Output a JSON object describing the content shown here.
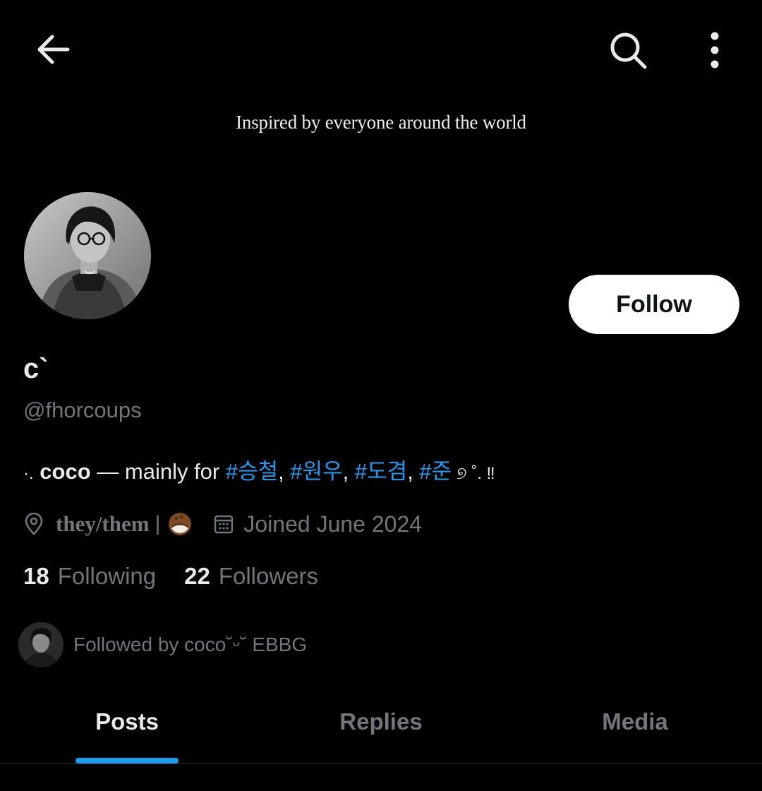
{
  "topbar": {
    "back_icon": "arrow-left-icon",
    "search_icon": "search-icon",
    "more_icon": "more-vertical-icon"
  },
  "banner": {
    "text": "Inspired by everyone around the world"
  },
  "profile": {
    "follow_label": "Follow",
    "display_name": "c`",
    "handle": "@fhorcoups",
    "bio": {
      "prefix": "·.",
      "name": "coco",
      "middle": " — mainly for ",
      "tags": [
        "#승철",
        "#원우",
        "#도겸",
        "#준"
      ],
      "separator": ", ",
      "suffix": " ୭ ˚. ‼"
    },
    "location": "they/them",
    "location_sep": "|",
    "location_emoji": "coconut-emoji",
    "joined": "Joined June 2024",
    "following_count": "18",
    "following_label": "Following",
    "followers_count": "22",
    "followers_label": "Followers",
    "followed_by": "Followed by coco˘ᵕ˘ EBBG"
  },
  "tabs": [
    {
      "label": "Posts",
      "active": true
    },
    {
      "label": "Replies",
      "active": false
    },
    {
      "label": "Media",
      "active": false
    }
  ],
  "colors": {
    "background": "#000000",
    "accent": "#1d9bf0",
    "secondary_text": "#71767b",
    "primary_text": "#e7e9ea"
  }
}
